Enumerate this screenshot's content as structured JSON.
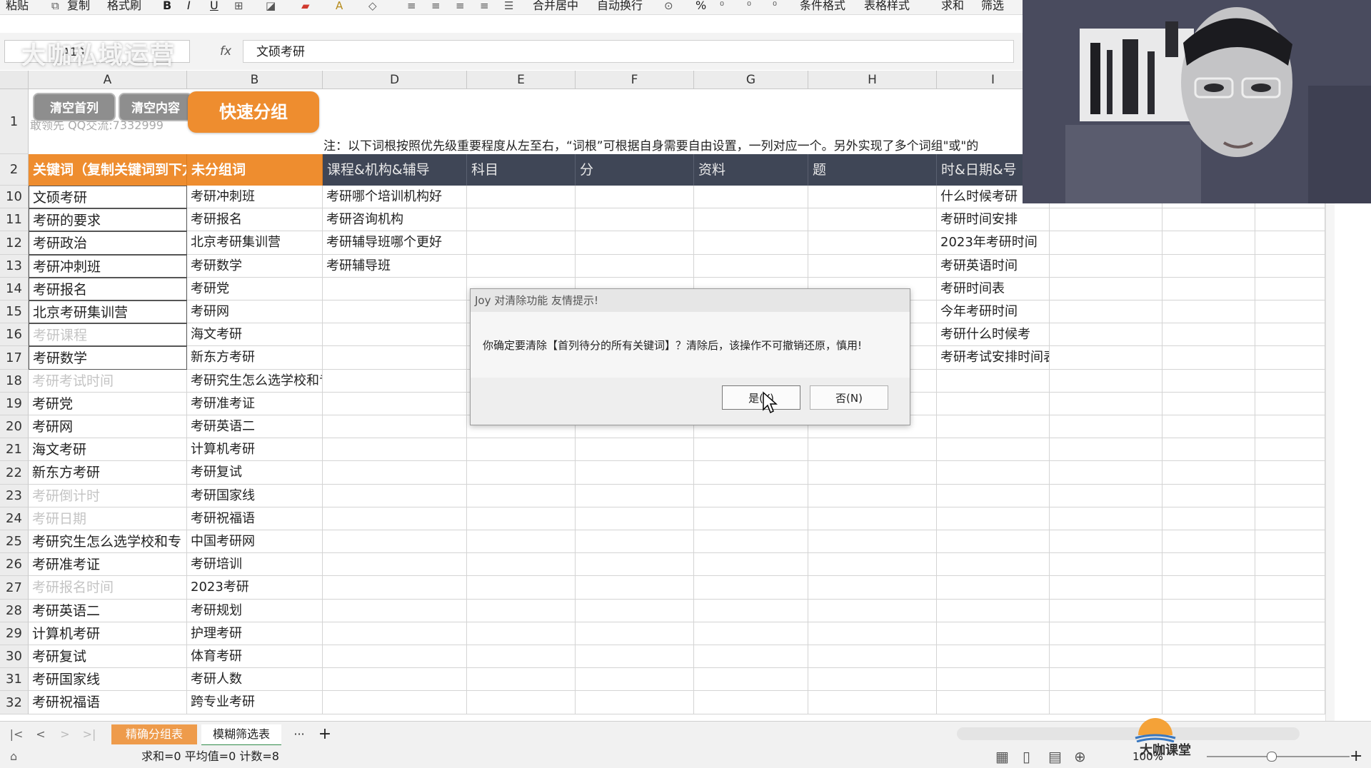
{
  "toolbar": {
    "paste": "粘贴",
    "copy": "复制",
    "format_painter": "格式刷",
    "bold": "B",
    "italic": "I",
    "underline": "U",
    "merge_center": "合并居中",
    "wrap_text": "自动换行",
    "percent": "%",
    "conditional_format": "条件格式",
    "table_style": "表格样式",
    "sum": "求和",
    "filter": "筛选"
  },
  "formula_bar": {
    "name_box": "A10",
    "fx": "fx",
    "content": "文硕考研",
    "watermark": "大咖私域运营"
  },
  "columns": [
    "A",
    "B",
    "D",
    "E",
    "F",
    "G",
    "H",
    "I"
  ],
  "buttons": {
    "clear_first_col": "清空首列",
    "clear_content": "清空内容",
    "quick_group": "快速分组"
  },
  "row1": {
    "contact": "敢领先 QQ交流:7332999",
    "note": "注：以下词根按照优先级重要程度从左至右，“词根”可根据自身需要自由设置，一列对应一个。另外实现了多个词组\"或\"的"
  },
  "row2": {
    "a": "关键词（复制关键词到下方",
    "b": "未分组词",
    "d": "课程&机构&辅导",
    "e": "科目",
    "f": "分",
    "g": "资料",
    "h": "题",
    "i": "时&日期&号"
  },
  "rows": [
    {
      "num": "10",
      "a": "文硕考研",
      "a_muted": false,
      "b": "考研冲刺班",
      "d": "考研哪个培训机构好",
      "i": "什么时候考研"
    },
    {
      "num": "11",
      "a": "考研的要求",
      "a_muted": false,
      "b": "考研报名",
      "d": "考研咨询机构",
      "i": "考研时间安排"
    },
    {
      "num": "12",
      "a": "考研政治",
      "a_muted": false,
      "b": "北京考研集训营",
      "d": "考研辅导班哪个更好",
      "i": "2023年考研时间"
    },
    {
      "num": "13",
      "a": "考研冲刺班",
      "a_muted": false,
      "b": "考研数学",
      "d": "考研辅导班",
      "i": "考研英语时间"
    },
    {
      "num": "14",
      "a": "考研报名",
      "a_muted": false,
      "b": "考研党",
      "d": "",
      "i": "考研时间表"
    },
    {
      "num": "15",
      "a": "北京考研集训营",
      "a_muted": false,
      "b": "考研网",
      "d": "",
      "i": "今年考研时间"
    },
    {
      "num": "16",
      "a": "考研课程",
      "a_muted": true,
      "b": "海文考研",
      "d": "",
      "i": "考研什么时候考"
    },
    {
      "num": "17",
      "a": "考研数学",
      "a_muted": false,
      "b": "新东方考研",
      "d": "",
      "i": "考研考试安排时间表"
    },
    {
      "num": "18",
      "a": "考研考试时间",
      "a_muted": true,
      "b": "考研究生怎么选学校和专",
      "d": "",
      "i": ""
    },
    {
      "num": "19",
      "a": "考研党",
      "a_muted": false,
      "b": "考研准考证",
      "d": "",
      "i": ""
    },
    {
      "num": "20",
      "a": "考研网",
      "a_muted": false,
      "b": "考研英语二",
      "d": "",
      "i": ""
    },
    {
      "num": "21",
      "a": "海文考研",
      "a_muted": false,
      "b": "计算机考研",
      "d": "",
      "i": ""
    },
    {
      "num": "22",
      "a": "新东方考研",
      "a_muted": false,
      "b": "考研复试",
      "d": "",
      "i": ""
    },
    {
      "num": "23",
      "a": "考研倒计时",
      "a_muted": true,
      "b": "考研国家线",
      "d": "",
      "i": ""
    },
    {
      "num": "24",
      "a": "考研日期",
      "a_muted": true,
      "b": "考研祝福语",
      "d": "",
      "i": ""
    },
    {
      "num": "25",
      "a": "考研究生怎么选学校和专",
      "a_muted": false,
      "b": "中国考研网",
      "d": "",
      "i": ""
    },
    {
      "num": "26",
      "a": "考研准考证",
      "a_muted": false,
      "b": "考研培训",
      "d": "",
      "i": ""
    },
    {
      "num": "27",
      "a": "考研报名时间",
      "a_muted": true,
      "b": "2023考研",
      "d": "",
      "i": ""
    },
    {
      "num": "28",
      "a": "考研英语二",
      "a_muted": false,
      "b": "考研规划",
      "d": "",
      "i": ""
    },
    {
      "num": "29",
      "a": "计算机考研",
      "a_muted": false,
      "b": "护理考研",
      "d": "",
      "i": ""
    },
    {
      "num": "30",
      "a": "考研复试",
      "a_muted": false,
      "b": "体育考研",
      "d": "",
      "i": ""
    },
    {
      "num": "31",
      "a": "考研国家线",
      "a_muted": false,
      "b": "考研人数",
      "d": "",
      "i": ""
    },
    {
      "num": "32",
      "a": "考研祝福语",
      "a_muted": false,
      "b": "跨专业考研",
      "d": "",
      "i": ""
    }
  ],
  "dialog": {
    "title": "Joy 对清除功能 友情提示!",
    "message": "你确定要清除【首列待分的所有关键词】？清除后，该操作不可撤销还原，慎用!",
    "yes": "是(Y)",
    "no": "否(N)"
  },
  "sheet_tabs": [
    "精确分组表",
    "模糊筛选表"
  ],
  "tab_more": "···",
  "tab_add": "+",
  "status": {
    "stats": "求和=0  平均值=0  计数=8",
    "zoom": "100%",
    "logo_text": "大咖课堂"
  },
  "colors": {
    "orange": "#EE8D2F",
    "dark_header": "#3F4656",
    "dialog_bg": "#F6F6F6"
  }
}
